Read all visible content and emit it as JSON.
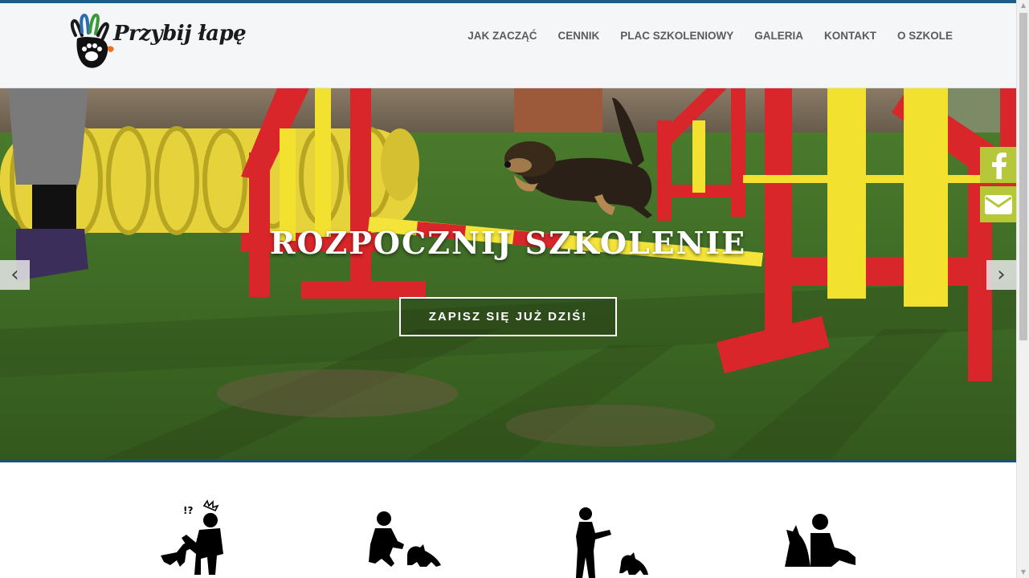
{
  "header": {
    "logo_text": "Przybij łapę",
    "nav": [
      "JAK ZACZĄĆ",
      "CENNIK",
      "PLAC SZKOLENIOWY",
      "GALERIA",
      "KONTAKT",
      "O SZKOLE"
    ]
  },
  "hero": {
    "title": "ROZPOCZNIJ SZKOLENIE",
    "cta_label": "ZAPISZ SIĘ JUŻ DZIŚ!",
    "prev_arrow": "‹",
    "next_arrow": "›"
  },
  "social": {
    "facebook_icon": "facebook-icon",
    "mail_icon": "envelope-icon",
    "color": "#b7c73a"
  },
  "features": {
    "icons": [
      "confused-person-with-dog-icon",
      "crouching-person-with-dog-icon",
      "person-pointing-at-dog-icon",
      "person-sitting-with-dog-icon"
    ]
  },
  "colors": {
    "accent": "#1f5d86",
    "nav_text": "#5b5b5b",
    "social_green": "#b7c73a"
  }
}
